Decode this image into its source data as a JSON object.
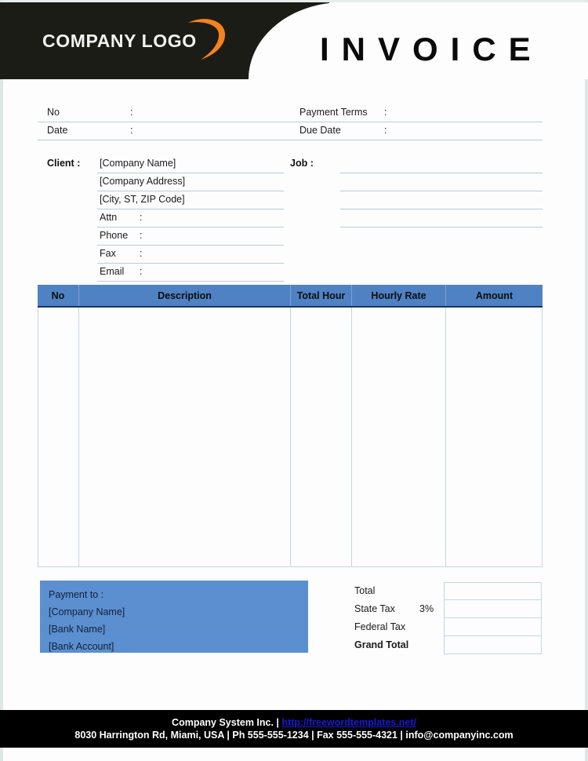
{
  "header": {
    "logo_text": "COMPANY LOGO",
    "logo_icon": "orange-swoosh-icon",
    "title": "INVOICE",
    "dark_color": "#1c1c16",
    "accent_color": "#f58220"
  },
  "meta": {
    "rows": [
      {
        "left_label": "No",
        "left_colon": ":",
        "left_value": "",
        "right_label": "Payment  Terms",
        "right_colon": ":",
        "right_value": ""
      },
      {
        "left_label": "Date",
        "left_colon": ":",
        "left_value": "",
        "right_label": "Due Date",
        "right_colon": ":",
        "right_value": ""
      }
    ]
  },
  "client": {
    "title": "Client :",
    "rows": [
      {
        "label": "[Company Name]",
        "colon": ""
      },
      {
        "label": "[Company Address]",
        "colon": ""
      },
      {
        "label": "[City, ST, ZIP Code]",
        "colon": ""
      },
      {
        "label": "Attn",
        "colon": ":"
      },
      {
        "label": "Phone",
        "colon": ":"
      },
      {
        "label": "Fax",
        "colon": ":"
      },
      {
        "label": "Email",
        "colon": ":"
      }
    ]
  },
  "job": {
    "title": "Job :",
    "rows": [
      "",
      "",
      "",
      ""
    ]
  },
  "items_table": {
    "columns": [
      "No",
      "Description",
      "Total Hour",
      "Hourly Rate",
      "Amount"
    ],
    "rows": [],
    "header_bg": "#4f82c3",
    "header_rule": "#17365d"
  },
  "payment": {
    "bg": "#5b8fd0",
    "lines": [
      "Payment to :",
      "[Company Name]",
      "[Bank Name]",
      "[Bank Account]"
    ]
  },
  "totals": {
    "rows": [
      {
        "label": "Total",
        "extra": "",
        "value": "",
        "bold": false
      },
      {
        "label": "State Tax",
        "extra": "3%",
        "value": "",
        "bold": false
      },
      {
        "label": "Federal Tax",
        "extra": "",
        "value": "",
        "bold": false
      },
      {
        "label": "Grand Total",
        "extra": "",
        "value": "",
        "bold": true
      }
    ]
  },
  "footer": {
    "line1_pre": "Company System Inc. | ",
    "line1_url": "http://freewordtemplates.net/",
    "line2": "8030 Harrington Rd, Miami, USA | Ph 555-555-1234 | Fax 555-555-4321 | info@companyinc.com",
    "url_color": "#1a1ad6"
  }
}
